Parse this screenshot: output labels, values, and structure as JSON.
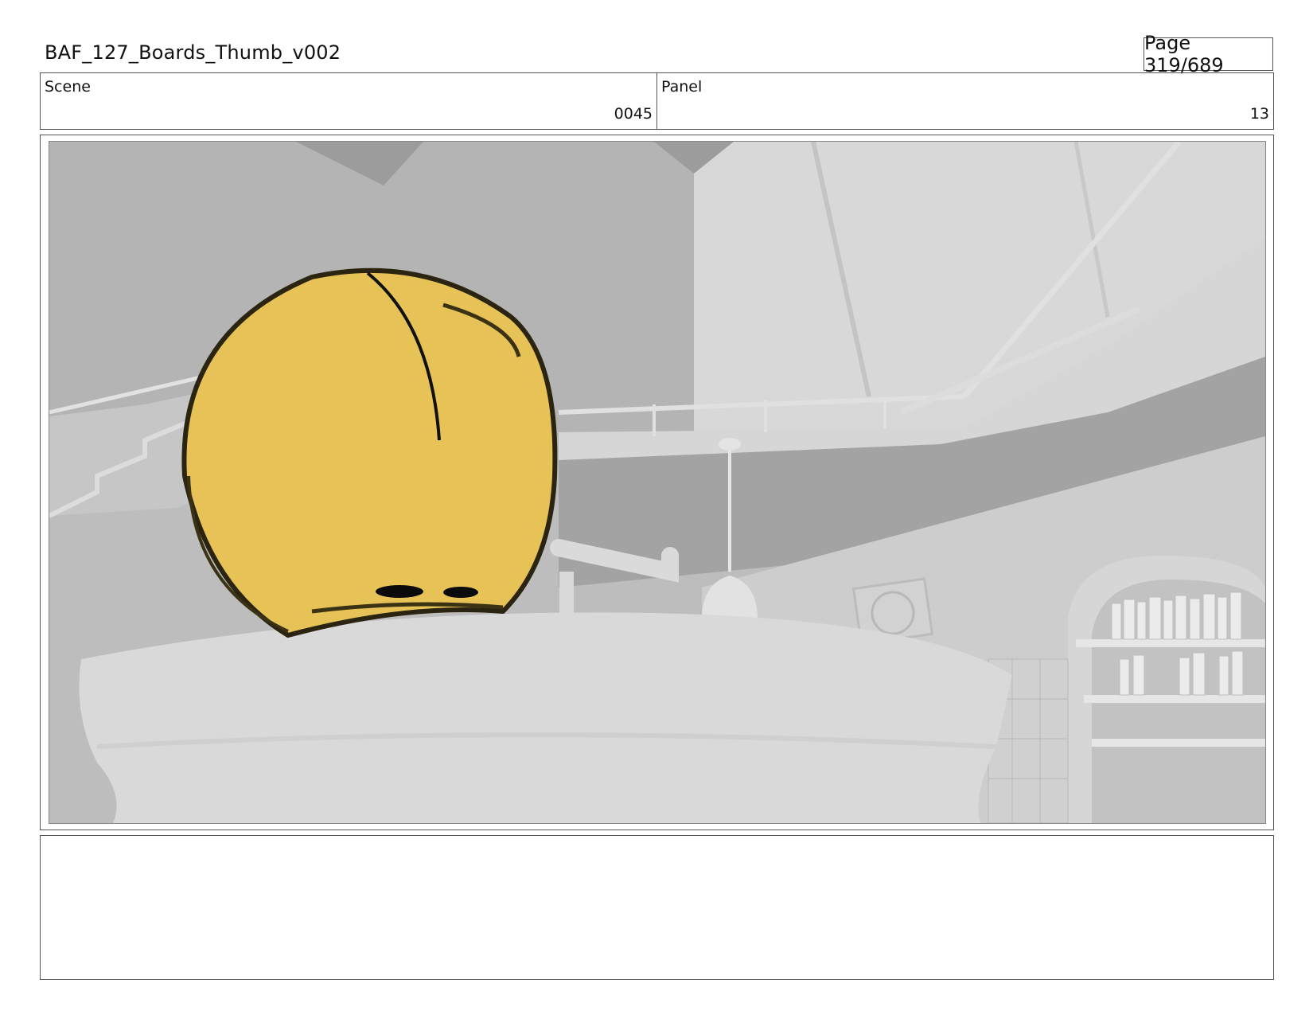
{
  "header": {
    "title": "BAF_127_Boards_Thumb_v002",
    "page": "Page 319/689"
  },
  "info": {
    "scene_label": "Scene",
    "scene_value": "0045",
    "panel_label": "Panel",
    "panel_value": "13"
  },
  "notes": {
    "text": ""
  },
  "colors": {
    "character_fill": "#E6C257",
    "character_outline": "#2a2410",
    "scene_grey": "#c8c8c8"
  }
}
